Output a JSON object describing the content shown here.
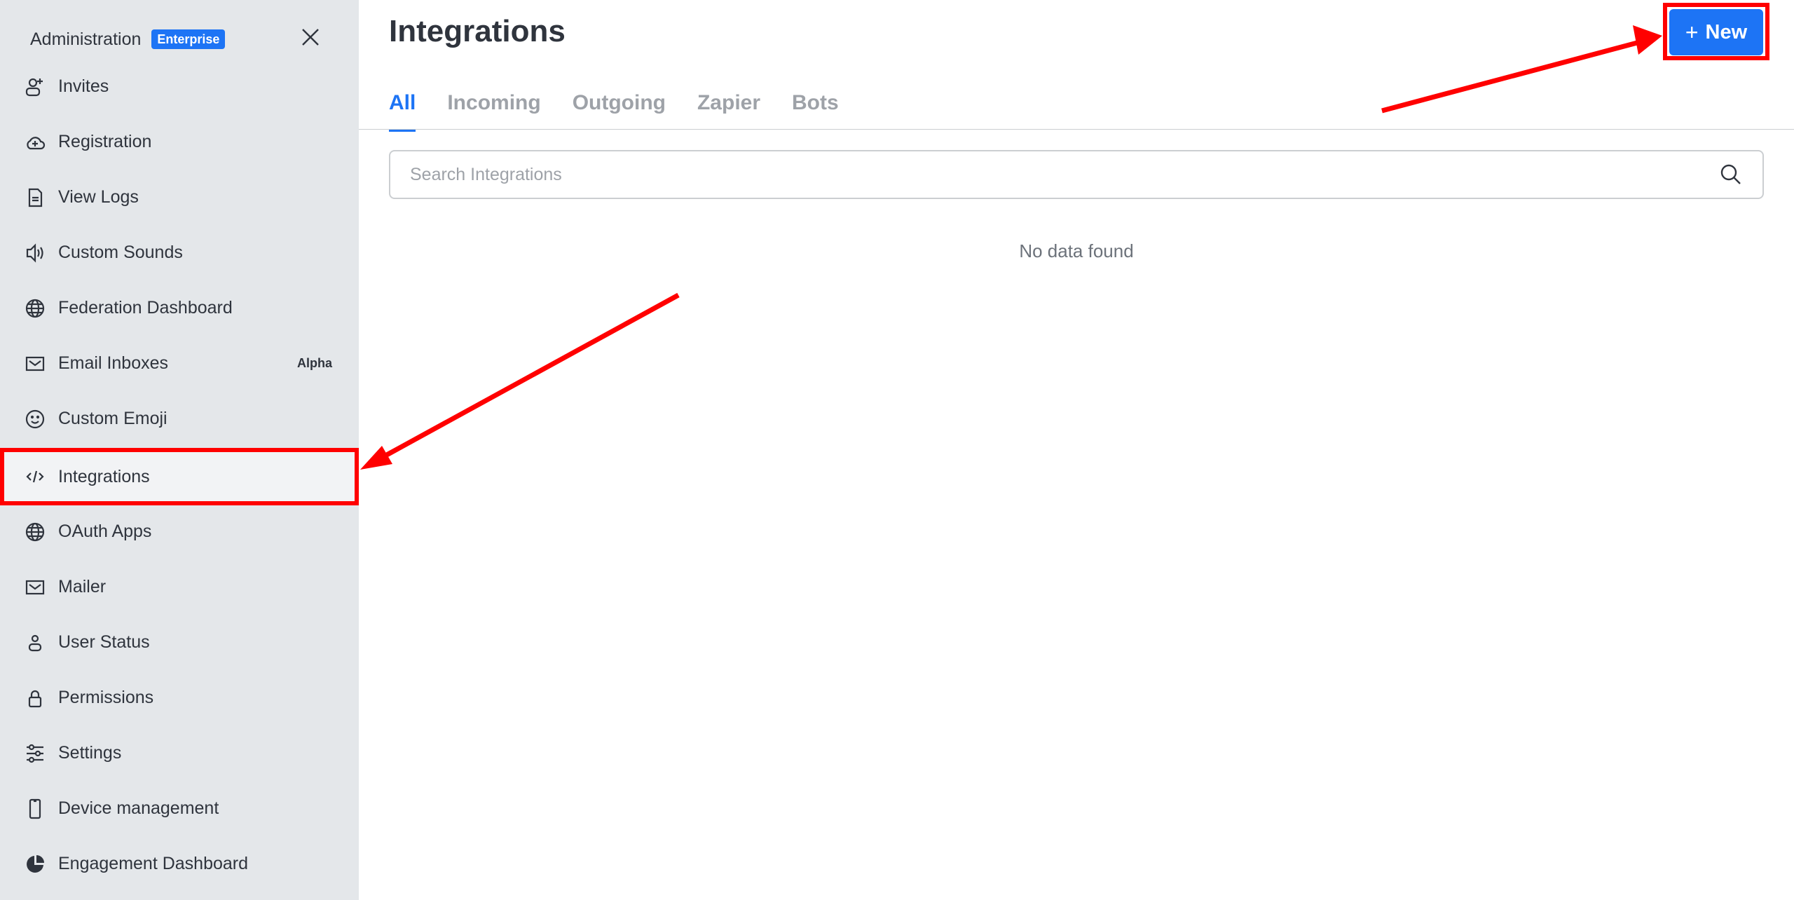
{
  "sidebar": {
    "title": "Administration",
    "badge": "Enterprise",
    "items": [
      {
        "label": "Invites",
        "icon": "user-plus-icon"
      },
      {
        "label": "Registration",
        "icon": "cloud-plus-icon"
      },
      {
        "label": "View Logs",
        "icon": "file-text-icon"
      },
      {
        "label": "Custom Sounds",
        "icon": "speaker-icon"
      },
      {
        "label": "Federation Dashboard",
        "icon": "globe-icon"
      },
      {
        "label": "Email Inboxes",
        "icon": "mail-icon",
        "tag": "Alpha"
      },
      {
        "label": "Custom Emoji",
        "icon": "smiley-icon"
      },
      {
        "label": "Integrations",
        "icon": "code-icon",
        "active": true
      },
      {
        "label": "OAuth Apps",
        "icon": "globe-icon"
      },
      {
        "label": "Mailer",
        "icon": "mail-icon"
      },
      {
        "label": "User Status",
        "icon": "user-icon"
      },
      {
        "label": "Permissions",
        "icon": "lock-icon"
      },
      {
        "label": "Settings",
        "icon": "sliders-icon"
      },
      {
        "label": "Device management",
        "icon": "mobile-icon"
      },
      {
        "label": "Engagement Dashboard",
        "icon": "pie-chart-icon"
      }
    ]
  },
  "header": {
    "title": "Integrations",
    "new_button": {
      "plus": "+",
      "label": "New"
    }
  },
  "tabs": [
    {
      "label": "All",
      "active": true
    },
    {
      "label": "Incoming"
    },
    {
      "label": "Outgoing"
    },
    {
      "label": "Zapier"
    },
    {
      "label": "Bots"
    }
  ],
  "search": {
    "placeholder": "Search Integrations",
    "value": ""
  },
  "empty_state": "No data found",
  "colors": {
    "accent": "#1d74f5",
    "annotation": "#ff0000",
    "sidebar_bg": "#e4e7ea"
  }
}
